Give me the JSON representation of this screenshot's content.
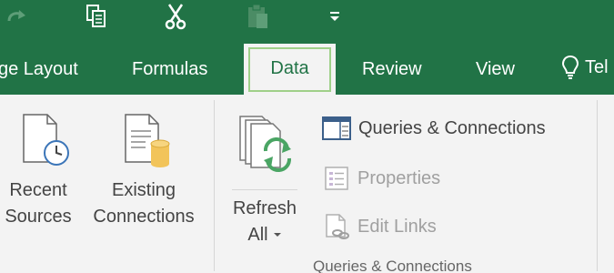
{
  "tabs": [
    {
      "label": "ge Layout"
    },
    {
      "label": "Formulas"
    },
    {
      "label": "Data"
    },
    {
      "label": "Review"
    },
    {
      "label": "View"
    },
    {
      "label": "Tel"
    }
  ],
  "ribbon": {
    "recent_sources": {
      "line1": "Recent",
      "line2": "Sources"
    },
    "existing_connections": {
      "line1": "Existing",
      "line2": "Connections"
    },
    "refresh_all": {
      "line1": "Refresh",
      "line2": "All"
    },
    "queries_connections": "Queries & Connections",
    "properties": "Properties",
    "edit_links": "Edit Links",
    "group_label": "Queries & Connections"
  },
  "colors": {
    "accent": "#217346",
    "focus": "#9fd089",
    "refresh_green": "#4aa564",
    "cylinder": "#f2c45a"
  }
}
